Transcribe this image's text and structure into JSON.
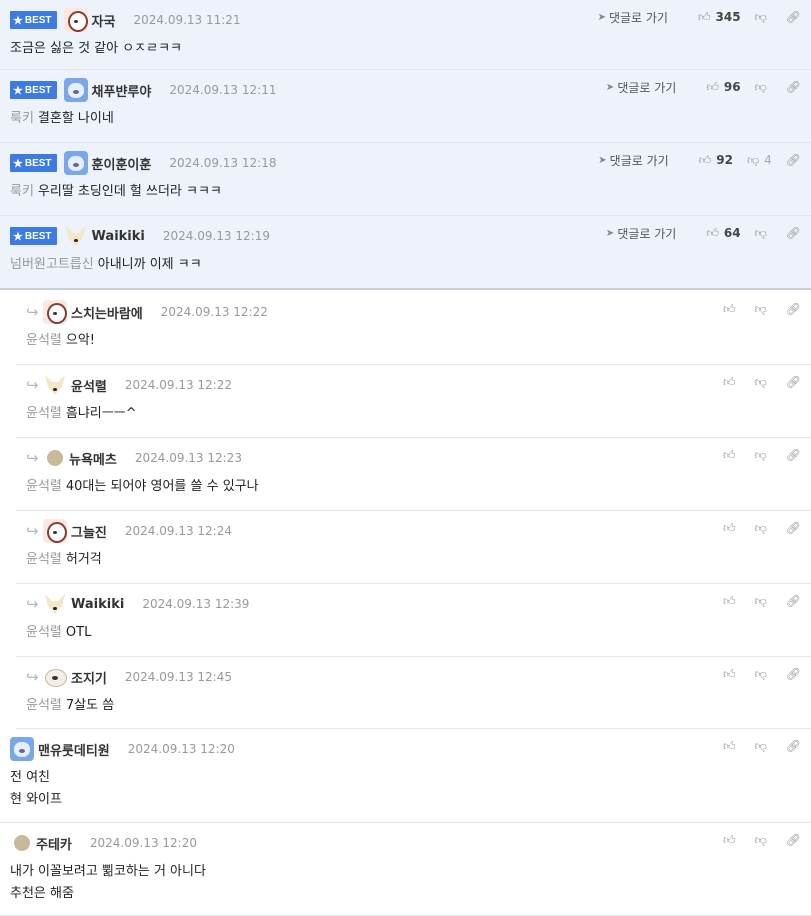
{
  "labels": {
    "best": "BEST",
    "goto": "댓글로 가기"
  },
  "comments": [
    {
      "nick": "자국",
      "date": "2024.09.13 11:21",
      "to": "",
      "text": "조금은 싫은 것 같아 ㅇㅈㄹㅋㅋ",
      "likes": "345",
      "dislikes": ""
    },
    {
      "nick": "채푸뱐루야",
      "date": "2024.09.13 12:11",
      "to": "룩키",
      "text": "결혼할 나이네",
      "likes": "96",
      "dislikes": ""
    },
    {
      "nick": "훈이훈이훈",
      "date": "2024.09.13 12:18",
      "to": "룩키",
      "text": "우리딸 초딩인데 헐 쓰더라 ㅋㅋㅋ",
      "likes": "92",
      "dislikes": "4"
    },
    {
      "nick": "Waikiki",
      "date": "2024.09.13 12:19",
      "to": "넘버원고트릅신",
      "text": "아내니까 이제 ㅋㅋ",
      "likes": "64",
      "dislikes": ""
    }
  ],
  "replies": [
    {
      "nick": "스치는바람에",
      "date": "2024.09.13 12:22",
      "to": "윤석렬",
      "text": "으악!"
    },
    {
      "nick": "윤석렬",
      "date": "2024.09.13 12:22",
      "to": "윤석렬",
      "text": "흠냐리ㅡㅡ^"
    },
    {
      "nick": "뉴욕메츠",
      "date": "2024.09.13 12:23",
      "to": "윤석렬",
      "text": "40대는 되어야 영어를 쓸 수 있구나"
    },
    {
      "nick": "그늘진",
      "date": "2024.09.13 12:24",
      "to": "윤석렬",
      "text": "허거걱"
    },
    {
      "nick": "Waikiki",
      "date": "2024.09.13 12:39",
      "to": "윤석렬",
      "text": "OTL"
    },
    {
      "nick": "조지기",
      "date": "2024.09.13 12:45",
      "to": "윤석렬",
      "text": "7살도 씀"
    }
  ],
  "tail": [
    {
      "nick": "맨유룻데티원",
      "date": "2024.09.13 12:20",
      "lines": [
        "전 여친",
        "현 와이프"
      ]
    },
    {
      "nick": "주테카",
      "date": "2024.09.13 12:20",
      "lines": [
        "내가 이꼴보려고 쀪코하는 거 아니다",
        "추천은 해줌"
      ]
    }
  ]
}
